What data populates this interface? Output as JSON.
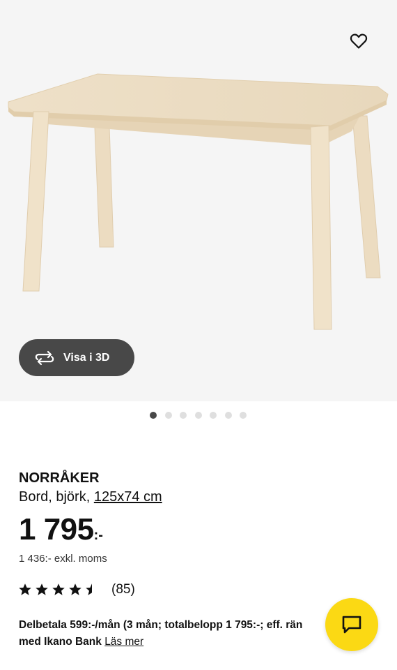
{
  "gallery": {
    "view_3d_label": "Visa i 3D",
    "image_count": 7,
    "active_index": 0
  },
  "product": {
    "name": "NORRÅKER",
    "type_prefix": "Bord, björk, ",
    "size_link": "125x74 cm",
    "price_integer": "1 795",
    "price_suffix": ":-",
    "price_excl_vat": "1 436:- exkl. moms",
    "rating_value": 4.5,
    "rating_count": "(85)"
  },
  "financing": {
    "line1": "Delbetala 599:-/mån (3 mån; totalbelopp 1 795:-; eff. rän",
    "line2": "med Ikano Bank",
    "read_more": "Läs mer"
  },
  "icons": {
    "favourite": "heart-outline-icon",
    "view_3d": "rotate-3d-icon",
    "rating": "star-icon",
    "chat": "chat-bubble-icon"
  },
  "colors": {
    "chat_button": "#fbd914",
    "dark_button": "#484848",
    "active_dot": "#484848",
    "inactive_dot": "#dfdfdf"
  }
}
